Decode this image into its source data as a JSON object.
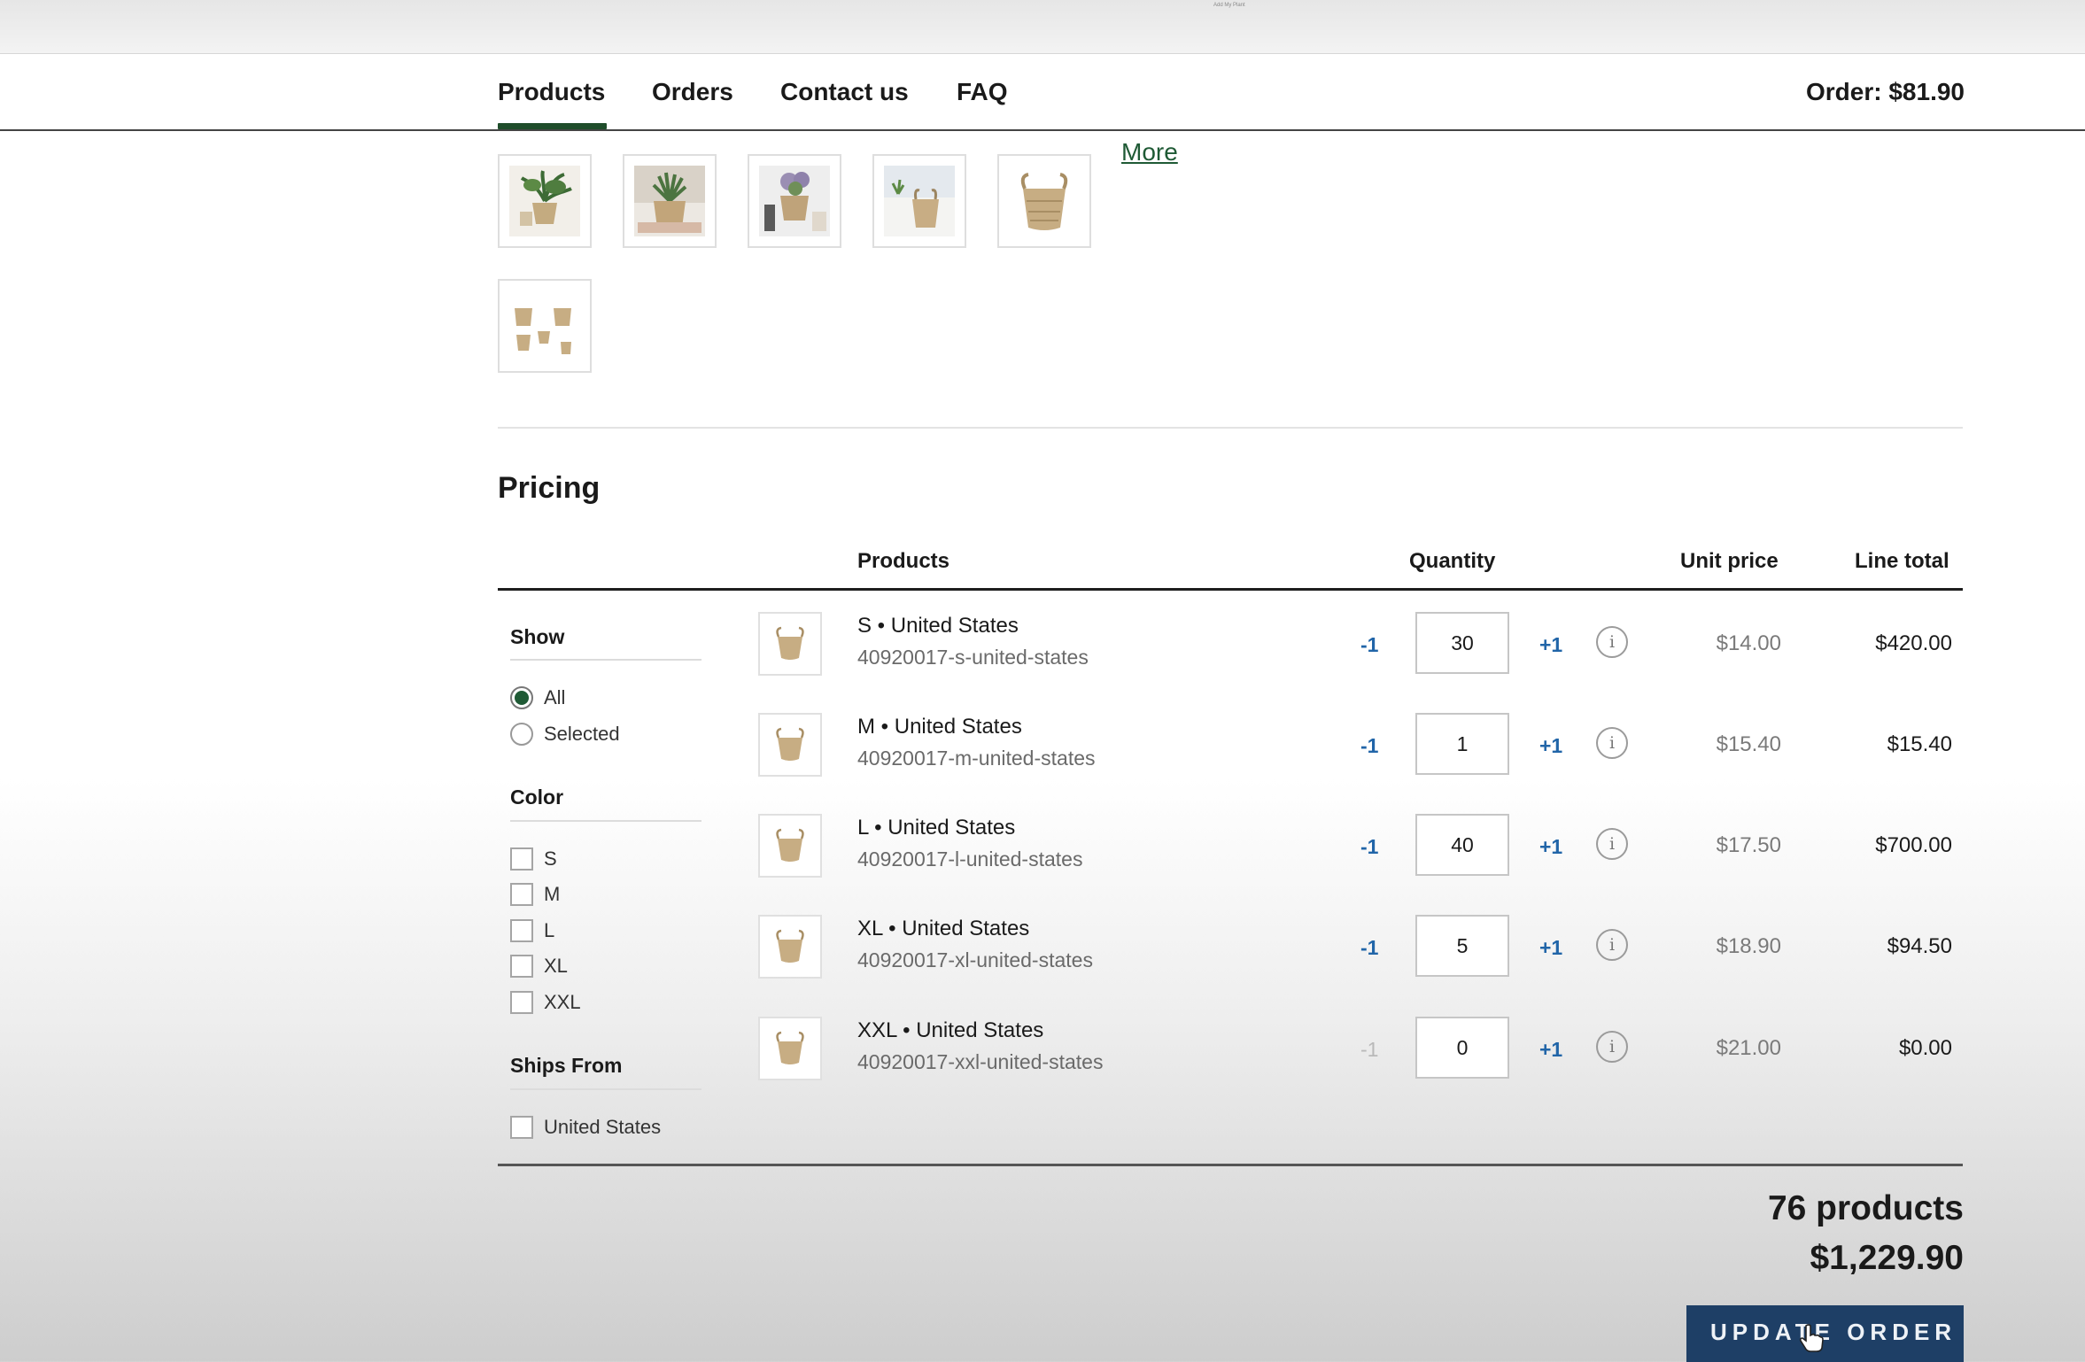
{
  "topbar": {
    "tiny_text": "Add My Plant"
  },
  "nav": {
    "tabs": [
      {
        "label": "Products"
      },
      {
        "label": "Orders"
      },
      {
        "label": "Contact us"
      },
      {
        "label": "FAQ"
      }
    ],
    "order_total": "Order: $81.90"
  },
  "gallery": {
    "more_label": "More"
  },
  "pricing": {
    "title": "Pricing",
    "columns": {
      "products": "Products",
      "quantity": "Quantity",
      "unit_price": "Unit price",
      "line_total": "Line total"
    },
    "rows": [
      {
        "name": "S • United States",
        "sku": "40920017-s-united-states",
        "minus": "-1",
        "qty": "30",
        "plus": "+1",
        "unit_price": "$14.00",
        "line_total": "$420.00"
      },
      {
        "name": "M • United States",
        "sku": "40920017-m-united-states",
        "minus": "-1",
        "qty": "1",
        "plus": "+1",
        "unit_price": "$15.40",
        "line_total": "$15.40"
      },
      {
        "name": "L • United States",
        "sku": "40920017-l-united-states",
        "minus": "-1",
        "qty": "40",
        "plus": "+1",
        "unit_price": "$17.50",
        "line_total": "$700.00"
      },
      {
        "name": "XL • United States",
        "sku": "40920017-xl-united-states",
        "minus": "-1",
        "qty": "5",
        "plus": "+1",
        "unit_price": "$18.90",
        "line_total": "$94.50"
      },
      {
        "name": "XXL • United States",
        "sku": "40920017-xxl-united-states",
        "minus": "-1",
        "qty": "0",
        "plus": "+1",
        "unit_price": "$21.00",
        "line_total": "$0.00"
      }
    ],
    "info_glyph": "i"
  },
  "filters": {
    "show": {
      "title": "Show",
      "options": [
        "All",
        "Selected"
      ],
      "selected": "All"
    },
    "color": {
      "title": "Color",
      "options": [
        "S",
        "M",
        "L",
        "XL",
        "XXL"
      ]
    },
    "ships_from": {
      "title": "Ships From",
      "options": [
        "United States"
      ]
    }
  },
  "summary": {
    "products_count": "76 products",
    "total": "$1,229.90",
    "update_label": "UPDATE ORDER"
  },
  "colors": {
    "accent_green": "#1f5a35",
    "link_blue": "#2165a8",
    "button_navy": "#1e3f66"
  }
}
